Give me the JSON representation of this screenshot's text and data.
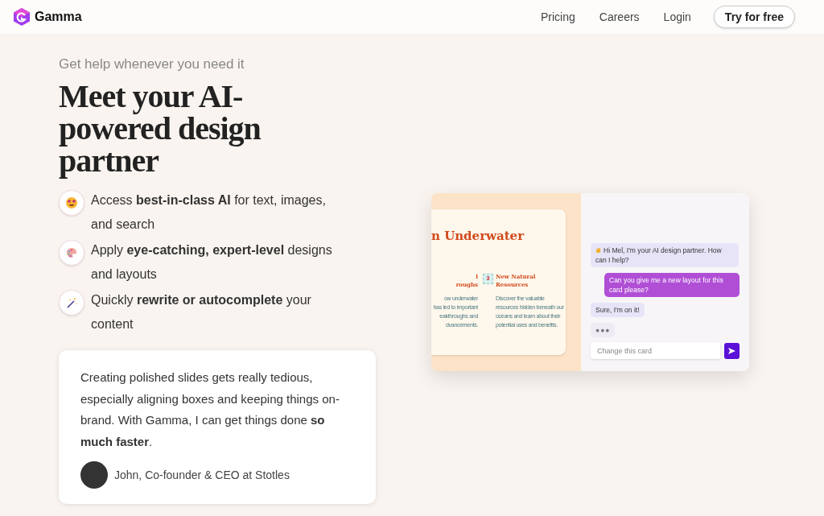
{
  "nav": {
    "brand": "Gamma",
    "links": [
      "Pricing",
      "Careers",
      "Login"
    ],
    "cta": "Try for free"
  },
  "hero": {
    "eyebrow": "Get help whenever you need it",
    "title": "Meet your AI-powered design partner",
    "features": [
      {
        "kind": "star-eyes",
        "text": "Access **best-in-class AI** for text, images, and search"
      },
      {
        "kind": "palette",
        "text": "Apply **eye-catching, expert-level** designs and layouts"
      },
      {
        "kind": "wand",
        "text": "Quickly **rewrite or autocomplete** your content"
      }
    ],
    "quote": {
      "text": "Creating polished slides gets really tedious, especially aligning boxes and keeping things on-brand. With Gamma, I can get things done **so much faster**.",
      "author": "John, Co-founder & CEO at Stotles"
    }
  },
  "preview": {
    "card": {
      "title": "n Underwater",
      "columns": [
        {
          "heading": [
            "l",
            "roughs"
          ],
          "body": [
            "ow underwater",
            "has led to important",
            "eakthroughs and",
            "dvancements."
          ]
        },
        {
          "badge": "3",
          "heading": [
            "New Natural",
            "Resources"
          ],
          "body": [
            "Discover the valuable",
            "resources hidden beneath our",
            "oceans and learn about their",
            "potential uses and benefits."
          ]
        }
      ]
    },
    "chat": {
      "messages": [
        {
          "kind": "ai",
          "wave": true,
          "text": "Hi Mel, I'm your AI design partner. How can I help?"
        },
        {
          "kind": "user",
          "wave": false,
          "text": "Can you give me a new layout for this card please?"
        },
        {
          "kind": "ai",
          "wave": false,
          "text": "Sure, I'm on it!"
        },
        {
          "kind": "typing",
          "wave": false,
          "text": "●●●"
        }
      ],
      "input": {
        "placeholder": "Change this card"
      }
    }
  }
}
